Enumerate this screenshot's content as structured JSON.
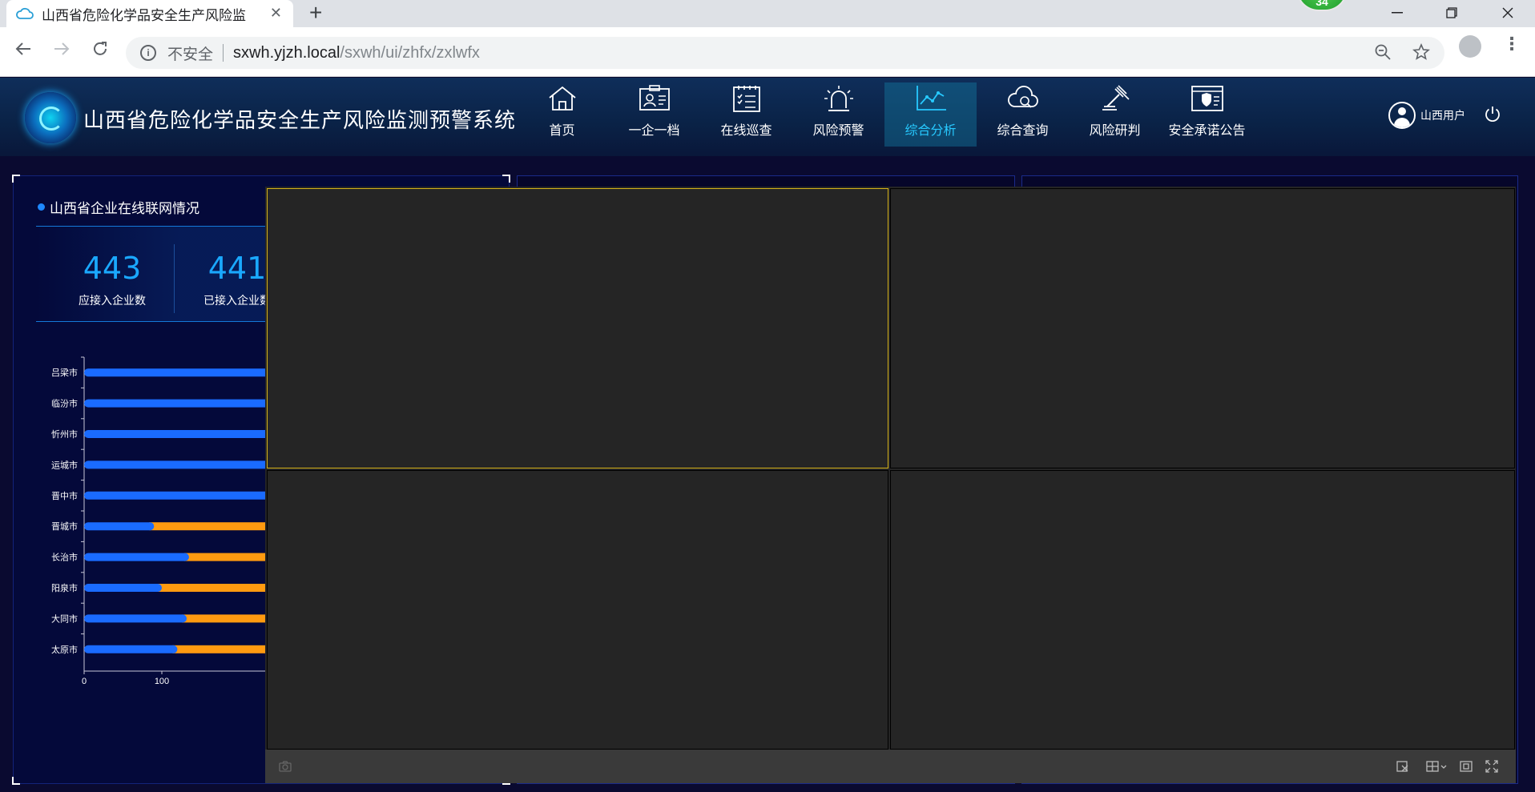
{
  "browser": {
    "tab_title": "山西省危险化学品安全生产风险监",
    "extension_badge": "34",
    "url_insecure_label": "不安全",
    "url_host": "sxwh.yjzh.local",
    "url_path": "/sxwh/ui/zhfx/zxlwfx"
  },
  "app": {
    "title": "山西省危险化学品安全生产风险监测预警系统",
    "nav": [
      {
        "label": "首页",
        "icon": "home-icon"
      },
      {
        "label": "一企一档",
        "icon": "id-card-icon"
      },
      {
        "label": "在线巡查",
        "icon": "checklist-icon"
      },
      {
        "label": "风险预警",
        "icon": "alarm-light-icon"
      },
      {
        "label": "综合分析",
        "icon": "line-chart-icon"
      },
      {
        "label": "综合查询",
        "icon": "cloud-search-icon"
      },
      {
        "label": "风险研判",
        "icon": "gavel-icon"
      },
      {
        "label": "安全承诺公告",
        "icon": "shield-document-icon"
      }
    ],
    "active_nav": "综合分析",
    "user_name": "山西用户"
  },
  "left_panel": {
    "title": "山西省企业在线联网情况",
    "stats": [
      {
        "value": "443",
        "label": "应接入企业数"
      },
      {
        "value": "441",
        "label": "已接入企业数"
      }
    ]
  },
  "chart_data": {
    "type": "bar",
    "orientation": "horizontal",
    "stacked": true,
    "categories": [
      "吕梁市",
      "临汾市",
      "忻州市",
      "运城市",
      "晋中市",
      "晋城市",
      "长治市",
      "阳泉市",
      "大同市",
      "太原市"
    ],
    "series": [
      {
        "color": "#1a6bff",
        "values": [
          null,
          null,
          null,
          null,
          null,
          90,
          135,
          100,
          132,
          120
        ]
      },
      {
        "color": "#ff9a10",
        "values": [
          null,
          null,
          null,
          null,
          null,
          null,
          null,
          null,
          null,
          null
        ]
      }
    ],
    "x_ticks": [
      "0",
      "100"
    ],
    "grid": false,
    "legend": "none"
  },
  "colors": {
    "accent": "#27c9ff",
    "stat_number": "#1aa8ff",
    "bar_blue": "#1a6bff",
    "bar_orange": "#ff9a10",
    "video_selected_border": "#d4b21a"
  }
}
